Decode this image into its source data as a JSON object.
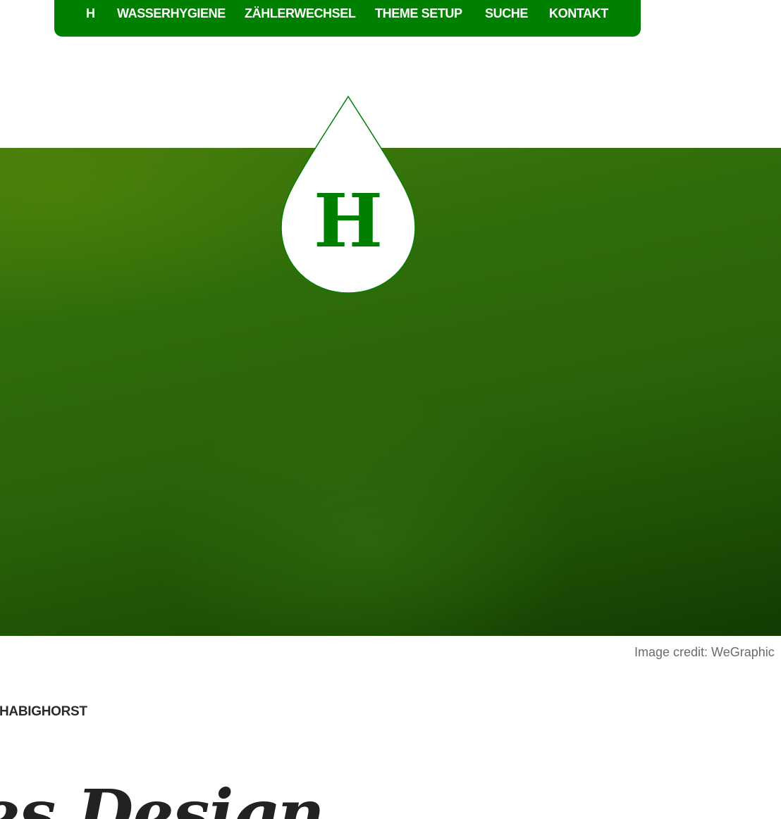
{
  "nav": {
    "items": [
      {
        "label": "H"
      },
      {
        "label": "WASSERHYGIENE"
      },
      {
        "label": "ZÄHLERWECHSEL"
      },
      {
        "label": "THEME SETUP"
      },
      {
        "label": "SUCHE"
      },
      {
        "label": "KONTAKT"
      }
    ],
    "background_color": "#008000"
  },
  "logo": {
    "letter": "H",
    "color": "#008000",
    "shape": "water-drop-icon"
  },
  "hero": {
    "image_credit": "Image credit: WeGraphic"
  },
  "post": {
    "author": "HABIGHORST",
    "title": "es Design"
  }
}
